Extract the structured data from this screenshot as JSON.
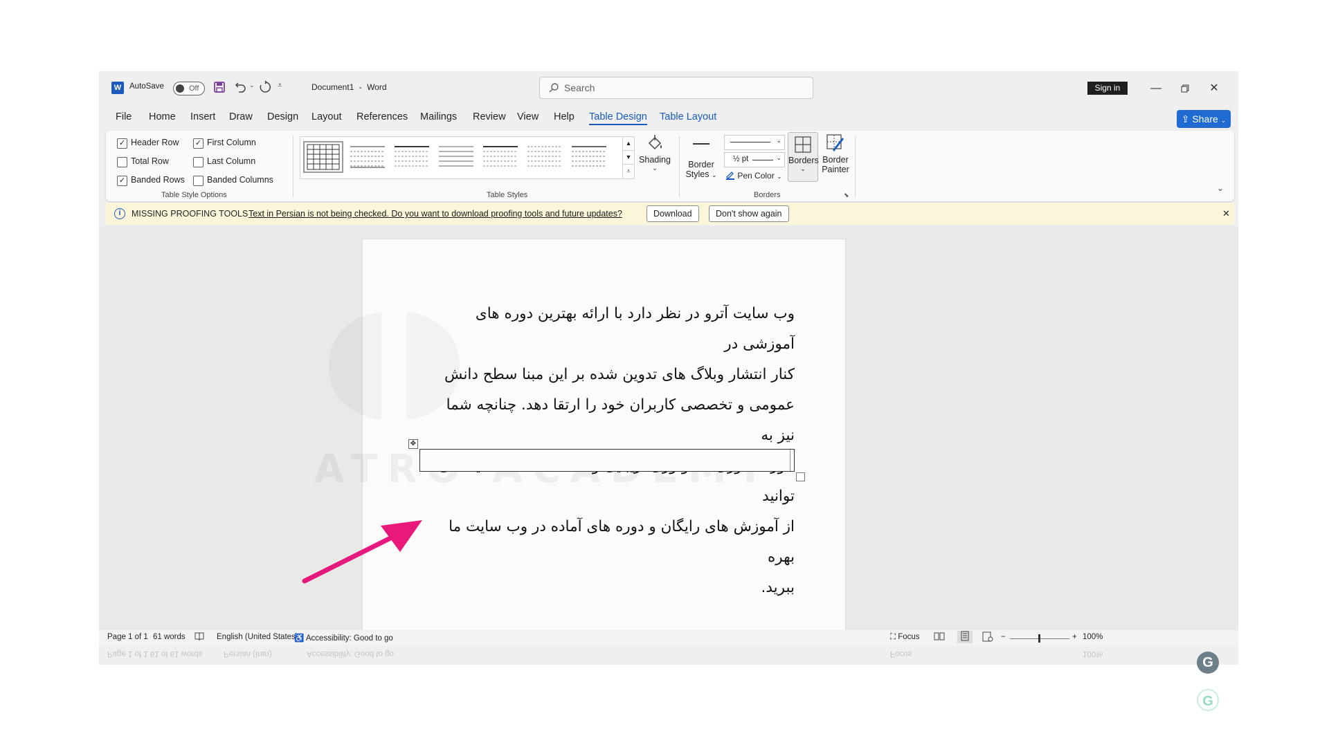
{
  "titlebar": {
    "app_icon": "W",
    "autosave_label": "AutoSave",
    "autosave_state": "Off",
    "doc_name": "Document1",
    "separator": "-",
    "app_name": "Word",
    "search_placeholder": "Search",
    "signin": "Sign in",
    "icons": [
      "save-icon",
      "undo-icon",
      "redo-icon",
      "customize-icon",
      "minimize-icon",
      "restore-icon",
      "close-icon"
    ]
  },
  "tabs": [
    {
      "label": "File"
    },
    {
      "label": "Home"
    },
    {
      "label": "Insert"
    },
    {
      "label": "Draw"
    },
    {
      "label": "Design"
    },
    {
      "label": "Layout"
    },
    {
      "label": "References"
    },
    {
      "label": "Mailings"
    },
    {
      "label": "Review"
    },
    {
      "label": "View"
    },
    {
      "label": "Help"
    },
    {
      "label": "Table Design"
    },
    {
      "label": "Table Layout"
    }
  ],
  "share_label": "Share",
  "ribbon": {
    "options": [
      {
        "label": "Header Row",
        "checked": true
      },
      {
        "label": "First Column",
        "checked": true
      },
      {
        "label": "Total Row",
        "checked": false
      },
      {
        "label": "Last Column",
        "checked": false
      },
      {
        "label": "Banded Rows",
        "checked": true
      },
      {
        "label": "Banded Columns",
        "checked": false
      }
    ],
    "options_group": "Table Style Options",
    "styles_group": "Table Styles",
    "shading": "Shading",
    "border_styles_1": "Border",
    "border_styles_2": "Styles",
    "pen_weight": "½ pt",
    "pen_color": "Pen Color",
    "borders": "Borders",
    "border_painter_1": "Border",
    "border_painter_2": "Painter",
    "borders_group": "Borders"
  },
  "infobar": {
    "title": "MISSING PROOFING TOOLS",
    "message": "Text in Persian is not being checked. Do you want to download proofing tools and future updates?",
    "download": "Download",
    "dont_show": "Don't show again",
    "close": "✕"
  },
  "document": {
    "paragraph_lines": [
      "وب سایت آترو در نظر دارد با ارائه بهترین دوره های آموزشی در",
      "کنار انتشار وبلاگ های تدوین شده بر این مبنا سطح  دانش",
      "عمومی و تخصصی کاربران خود را ارتقا دهد. چنانچه شما نیز به",
      "حوزه فناوری، تکنولوژی، زیبایی و ... علاقه مند هستید، می توانید",
      "از آموزش های رایگان و دوره های آماده در وب سایت ما بهره",
      "ببرید."
    ],
    "watermark": "ATRO ACADEMY"
  },
  "status": {
    "page": "Page 1 of 1",
    "words": "61 words",
    "language": "English (United States)",
    "accessibility": "Accessibility: Good to go",
    "focus": "Focus",
    "zoom": "100%",
    "zoom_minus": "−",
    "zoom_plus": "+"
  },
  "reflection": {
    "page": "Page 1 of 1",
    "words": "61 of 61 words",
    "language": "Persian (Iran)",
    "accessibility": "Accessibility: Good to go",
    "focus": "Focus",
    "zoom": "100%"
  },
  "colors": {
    "accent": "#185abd",
    "arrow": "#e8197a",
    "infobar": "#fbf6d9"
  }
}
